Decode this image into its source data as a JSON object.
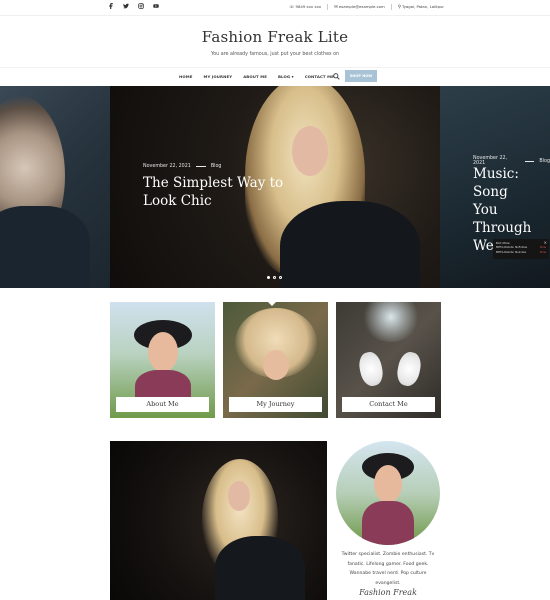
{
  "topbar": {
    "social": [
      "facebook-icon",
      "twitter-icon",
      "instagram-icon",
      "youtube-icon"
    ],
    "phone": "9849 xxx xxx",
    "email": "example@example.com",
    "location": "Tyagal, Patan, Lalitpur"
  },
  "branding": {
    "title": "Fashion Freak Lite",
    "tagline": "You are already famous, just put your best clothes on"
  },
  "nav": {
    "items": [
      "HOME",
      "MY JOURNEY",
      "ABOUT ME",
      "BLOG ▾",
      "CONTACT ME"
    ],
    "shop_label": "SHOP NOW",
    "accent_color": "#a9c3d6"
  },
  "slider": {
    "main": {
      "date": "November 22, 2021",
      "category": "Blog",
      "title_line1": "The Simplest Way to",
      "title_line2": "Look Chic"
    },
    "next": {
      "date": "November 22, 2021",
      "category": "Blog",
      "title_line1": "Music: Song",
      "title_line2": "You Through",
      "title_line3": "Weekend"
    },
    "dots_active_index": 0
  },
  "popup": {
    "title": "Bird Xtlow",
    "rows": [
      {
        "label": "META-Robots: NoFollow",
        "value": "Dow"
      },
      {
        "label": "META-Robots: Noindex",
        "value": "Dow"
      }
    ]
  },
  "cards": [
    {
      "label": "About Me"
    },
    {
      "label": "My Journey"
    },
    {
      "label": "Contact Me"
    }
  ],
  "author": {
    "bio_line1": "Twitter specialist. Zombie enthusiast. Tv",
    "bio_line2": "fanatic. Lifelong gamer. Food geek.",
    "bio_line3": "Wannabe travel nerd. Pop culture",
    "bio_line4": "evangelist.",
    "signature": "Fashion Freak"
  }
}
